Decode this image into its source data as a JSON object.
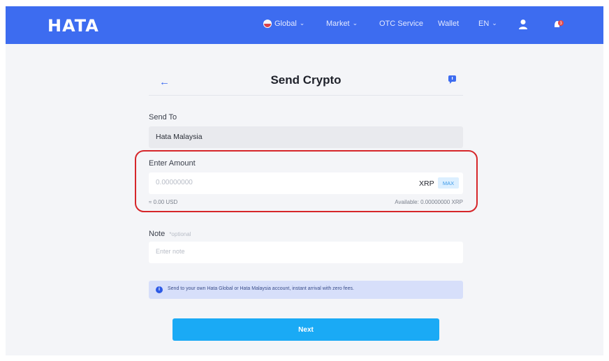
{
  "header": {
    "logo": "HATA",
    "nav": {
      "global": "Global",
      "market": "Market",
      "otc": "OTC Service",
      "wallet": "Wallet",
      "language": "EN"
    },
    "notification_count": "3"
  },
  "page": {
    "title": "Send Crypto",
    "send_to": {
      "label": "Send To",
      "value": "Hata Malaysia"
    },
    "amount": {
      "label": "Enter Amount",
      "placeholder": "0.00000000",
      "currency": "XRP",
      "max_label": "MAX",
      "usd_estimate": "≈ 0.00 USD",
      "available": "Available: 0.00000000 XRP"
    },
    "note": {
      "label": "Note",
      "optional": "*optional",
      "placeholder": "Enter note"
    },
    "info": "Send to your own Hata Global or Hata Malaysia account, instant arrival with zero fees.",
    "next_label": "Next"
  },
  "colors": {
    "navbar": "#3d6cf0",
    "primary_button": "#1aaaf5",
    "highlight": "#d6262a"
  }
}
